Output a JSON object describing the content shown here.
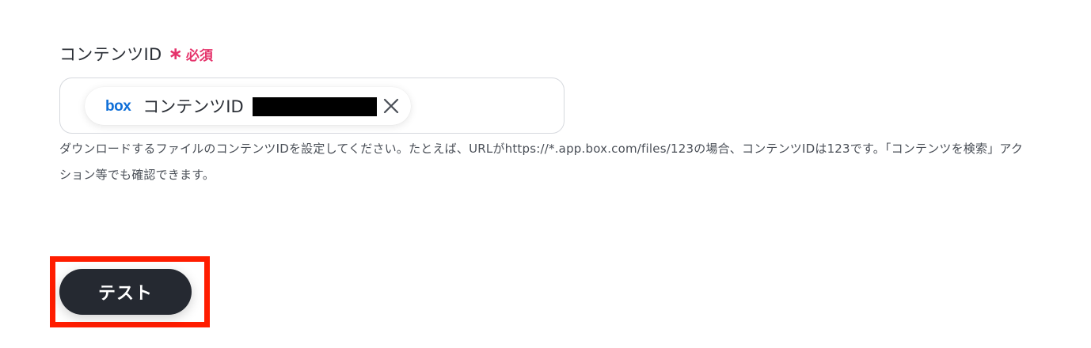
{
  "field": {
    "label": "コンテンツID",
    "required_mark": "∗",
    "required_text": "必須",
    "required_color": "#e5336b"
  },
  "token": {
    "logo_text": "box",
    "logo_color": "#0f6fd8",
    "label": "コンテンツID",
    "icon": "close-icon"
  },
  "help_text": "ダウンロードするファイルのコンテンツIDを設定してください。たとえば、URLがhttps://*.app.box.com/files/123の場合、コンテンツIDは123です。「コンテンツを検索」アクション等でも確認できます。",
  "test_button": {
    "label": "テスト",
    "background": "#252931"
  },
  "highlight_color": "#ff1d00"
}
